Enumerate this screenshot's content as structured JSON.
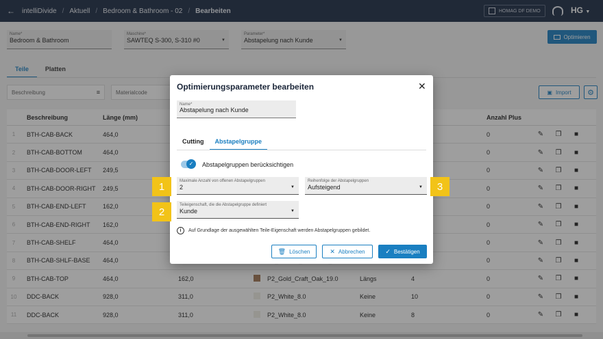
{
  "topbar": {
    "menu_icon": "back-arrow-icon",
    "crumbs": [
      "intelliDivide",
      "Aktuell",
      "Bedroom & Bathroom - 02",
      "Bearbeiten"
    ],
    "tenant": "HOMAG DF DEMO",
    "brand": "HG"
  },
  "header": {
    "name_label": "Name*",
    "name_value": "Bedroom & Bathroom",
    "machine_label": "Maschine*",
    "machine_value": "SAWTEQ S-300, S-310 #0",
    "param_label": "Parameter*",
    "param_value": "Abstapelung nach Kunde",
    "optimize_label": "Optimieren"
  },
  "tabs": [
    "Teile",
    "Platten"
  ],
  "filters": {
    "desc_placeholder": "Beschreibung",
    "material_placeholder": "Materialcode",
    "import_label": "Import"
  },
  "table": {
    "columns": [
      "Beschreibung",
      "Länge (mm)",
      "",
      "",
      "",
      "hl",
      "Anzahl Plus"
    ],
    "rows": [
      {
        "idx": "1",
        "desc": "BTH-CAB-BACK",
        "len": "464,0",
        "wid": "",
        "mat": "",
        "grain": "",
        "qty": "",
        "plus": "0"
      },
      {
        "idx": "2",
        "desc": "BTH-CAB-BOTTOM",
        "len": "464,0",
        "wid": "",
        "mat": "",
        "grain": "",
        "qty": "",
        "plus": "0"
      },
      {
        "idx": "3",
        "desc": "BTH-CAB-DOOR-LEFT",
        "len": "249,5",
        "wid": "",
        "mat": "",
        "grain": "",
        "qty": "",
        "plus": "0"
      },
      {
        "idx": "4",
        "desc": "BTH-CAB-DOOR-RIGHT",
        "len": "249,5",
        "wid": "",
        "mat": "",
        "grain": "",
        "qty": "",
        "plus": "0"
      },
      {
        "idx": "5",
        "desc": "BTH-CAB-END-LEFT",
        "len": "162,0",
        "wid": "",
        "mat": "",
        "grain": "",
        "qty": "",
        "plus": "0"
      },
      {
        "idx": "6",
        "desc": "BTH-CAB-END-RIGHT",
        "len": "162,0",
        "wid": "",
        "mat": "",
        "grain": "",
        "qty": "",
        "plus": "0"
      },
      {
        "idx": "7",
        "desc": "BTH-CAB-SHELF",
        "len": "464,0",
        "wid": "",
        "mat": "",
        "grain": "",
        "qty": "",
        "plus": "0"
      },
      {
        "idx": "8",
        "desc": "BTH-CAB-SHLF-BASE",
        "len": "464,0",
        "wid": "162,0",
        "mat": "P2_Rustica_Anderson_Pine...",
        "grain": "Längs",
        "qty": "4",
        "plus": "0"
      },
      {
        "idx": "9",
        "desc": "BTH-CAB-TOP",
        "len": "464,0",
        "wid": "162,0",
        "mat": "P2_Gold_Craft_Oak_19.0",
        "grain": "Längs",
        "qty": "4",
        "plus": "0"
      },
      {
        "idx": "10",
        "desc": "DDC-BACK",
        "len": "928,0",
        "wid": "311,0",
        "mat": "P2_White_8.0",
        "grain": "Keine",
        "qty": "10",
        "plus": "0"
      },
      {
        "idx": "11",
        "desc": "DDC-BACK",
        "len": "928,0",
        "wid": "311,0",
        "mat": "P2_White_8.0",
        "grain": "Keine",
        "qty": "8",
        "plus": "0"
      }
    ],
    "row_swatches": [
      "",
      "",
      "",
      "",
      "",
      "",
      "",
      "#b8b8b8",
      "#a07552",
      "#f1efe6",
      "#f1efe6"
    ],
    "action_icons": [
      "pencil-icon",
      "copy-icon",
      "trash-icon"
    ]
  },
  "modal": {
    "title": "Optimierungsparameter bearbeiten",
    "name_label": "Name*",
    "name_value": "Abstapelung nach Kunde",
    "tabs": [
      "Cutting",
      "Abstapelgruppe"
    ],
    "toggle_label": "Abstapelgruppen berücksichtigen",
    "toggle_on": true,
    "max_groups_label": "Maximale Anzahl von offenen Abstapelgruppen",
    "max_groups_value": "2",
    "order_label": "Reihenfolge der Abstapelgruppen",
    "order_value": "Aufsteigend",
    "property_label": "Teileigenschaft, die die Abstapelgruppe definiert",
    "property_value": "Kunde",
    "info_text": "Auf Grundlage der ausgewählten Teile-Eigenschaft werden Abstapelgruppen gebildet.",
    "delete_label": "Löschen",
    "cancel_label": "Abbrechen",
    "confirm_label": "Bestätigen"
  },
  "markers": [
    "1",
    "2",
    "3"
  ],
  "colors": {
    "accent": "#1a7fc1",
    "topbar": "#1b2a44",
    "marker": "#f2c318"
  }
}
